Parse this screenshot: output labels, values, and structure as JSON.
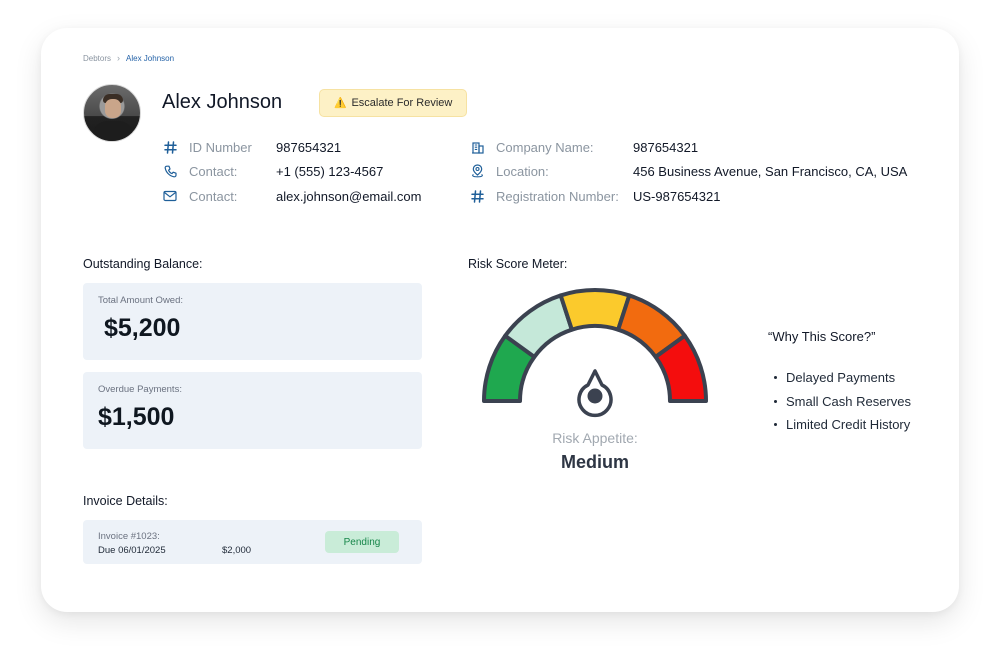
{
  "breadcrumb": {
    "root": "Debtors",
    "current": "Alex Johnson"
  },
  "debtor": {
    "name": "Alex Johnson"
  },
  "escalate": {
    "icon": "warning-icon",
    "label": "Escalate For Review"
  },
  "info_left": [
    {
      "icon": "hash-icon",
      "label": "ID Number",
      "value": "987654321"
    },
    {
      "icon": "phone-icon",
      "label": "Contact:",
      "value": "+1 (555) 123-4567"
    },
    {
      "icon": "mail-icon",
      "label": "Contact:",
      "value": "alex.johnson@email.com"
    }
  ],
  "info_right": [
    {
      "icon": "building-icon",
      "label": "Company Name:",
      "value": "987654321"
    },
    {
      "icon": "location-icon",
      "label": "Location:",
      "value": "456 Business Avenue, San Francisco, CA, USA"
    },
    {
      "icon": "hash-icon",
      "label": "Registration Number:",
      "value": "US-987654321"
    }
  ],
  "outstanding": {
    "title": "Outstanding Balance:",
    "total_label": "Total Amount Owed:",
    "total_value": "$5,200",
    "overdue_label": "Overdue Payments:",
    "overdue_value": "$1,500"
  },
  "invoices": {
    "title": "Invoice Details:",
    "items": [
      {
        "number": "Invoice #1023:",
        "due": "Due 06/01/2025",
        "amount": "$2,000",
        "status": "Pending"
      }
    ]
  },
  "risk": {
    "title": "Risk Score Meter:",
    "appetite_label": "Risk Appetite:",
    "appetite_value": "Medium",
    "segment_colors": [
      "#1fa84f",
      "#c5e8d9",
      "#fbca2c",
      "#f26b0f",
      "#f40d0d"
    ],
    "why_title": "“Why This Score?”",
    "reasons": [
      "Delayed Payments",
      "Small Cash Reserves",
      "Limited Credit History"
    ]
  },
  "colors": {
    "accent": "#1f5f99",
    "pending_bg": "#c9ecd8",
    "pending_text": "#17864a",
    "escalate_bg": "#fdf1c6"
  }
}
